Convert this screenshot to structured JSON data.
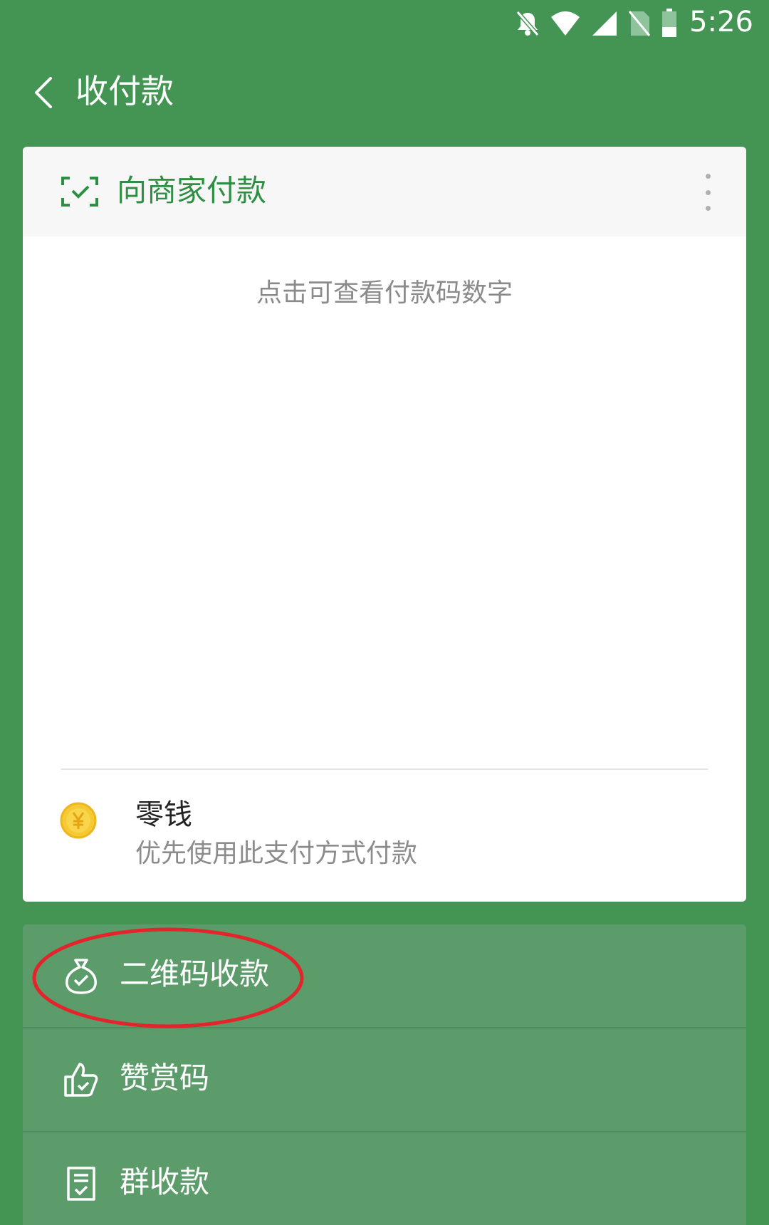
{
  "status": {
    "time": "5:26"
  },
  "header": {
    "title": "收付款"
  },
  "pay_card": {
    "title": "向商家付款",
    "hint": "点击可查看付款码数字",
    "method": {
      "name": "零钱",
      "description": "优先使用此支付方式付款"
    }
  },
  "menu": {
    "items": [
      {
        "label": "二维码收款",
        "icon": "money-bag-icon"
      },
      {
        "label": "赞赏码",
        "icon": "thumbs-up-icon"
      },
      {
        "label": "群收款",
        "icon": "document-icon"
      }
    ]
  },
  "colors": {
    "background": "#449554",
    "accent": "#2e8e44",
    "menu": "#5c9c6b",
    "annotation": "#e3242b"
  }
}
